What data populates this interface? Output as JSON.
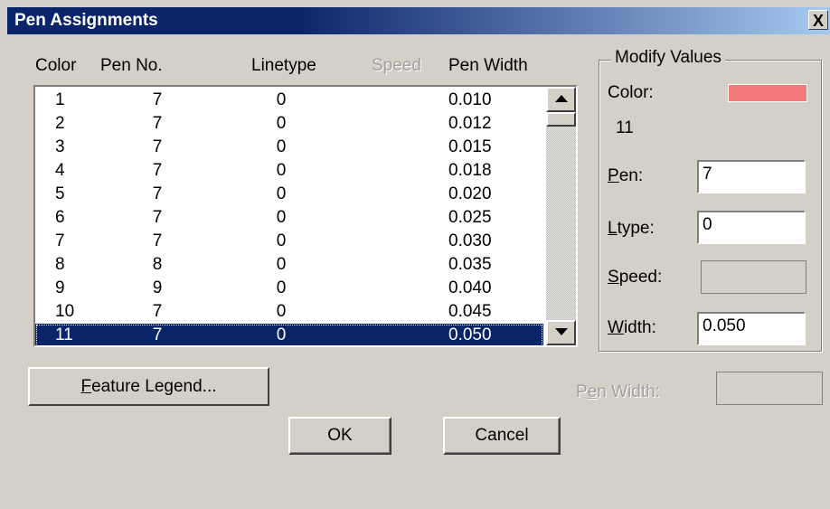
{
  "window": {
    "title": "Pen Assignments",
    "close_glyph": "X"
  },
  "columns": {
    "color": "Color",
    "pen_no": "Pen No.",
    "linetype": "Linetype",
    "speed": "Speed",
    "pen_width": "Pen Width"
  },
  "rows": [
    {
      "color": "1",
      "pen": "7",
      "linetype": "0",
      "width": "0.010"
    },
    {
      "color": "2",
      "pen": "7",
      "linetype": "0",
      "width": "0.012"
    },
    {
      "color": "3",
      "pen": "7",
      "linetype": "0",
      "width": "0.015"
    },
    {
      "color": "4",
      "pen": "7",
      "linetype": "0",
      "width": "0.018"
    },
    {
      "color": "5",
      "pen": "7",
      "linetype": "0",
      "width": "0.020"
    },
    {
      "color": "6",
      "pen": "7",
      "linetype": "0",
      "width": "0.025"
    },
    {
      "color": "7",
      "pen": "7",
      "linetype": "0",
      "width": "0.030"
    },
    {
      "color": "8",
      "pen": "8",
      "linetype": "0",
      "width": "0.035"
    },
    {
      "color": "9",
      "pen": "9",
      "linetype": "0",
      "width": "0.040"
    },
    {
      "color": "10",
      "pen": "7",
      "linetype": "0",
      "width": "0.045"
    },
    {
      "color": "11",
      "pen": "7",
      "linetype": "0",
      "width": "0.050"
    }
  ],
  "selected_row": 10,
  "modify": {
    "group_label": "Modify Values",
    "color_label": "Color:",
    "color_value": "11",
    "color_swatch": "#f47a7a",
    "pen_label_hot": "P",
    "pen_label_rest": "en:",
    "pen_value": "7",
    "ltype_label_hot": "L",
    "ltype_label_rest": "type:",
    "ltype_value": "0",
    "speed_label_hot": "S",
    "speed_label_rest": "peed:",
    "speed_value": "",
    "width_label_hot": "W",
    "width_label_rest": "idth:",
    "width_value": "0.050"
  },
  "feature_legend": {
    "hot": "F",
    "rest": "eature Legend..."
  },
  "pen_width_bottom": {
    "pre": "P",
    "hot": "e",
    "rest": "n Width:",
    "value": ""
  },
  "buttons": {
    "ok": "OK",
    "cancel": "Cancel"
  }
}
